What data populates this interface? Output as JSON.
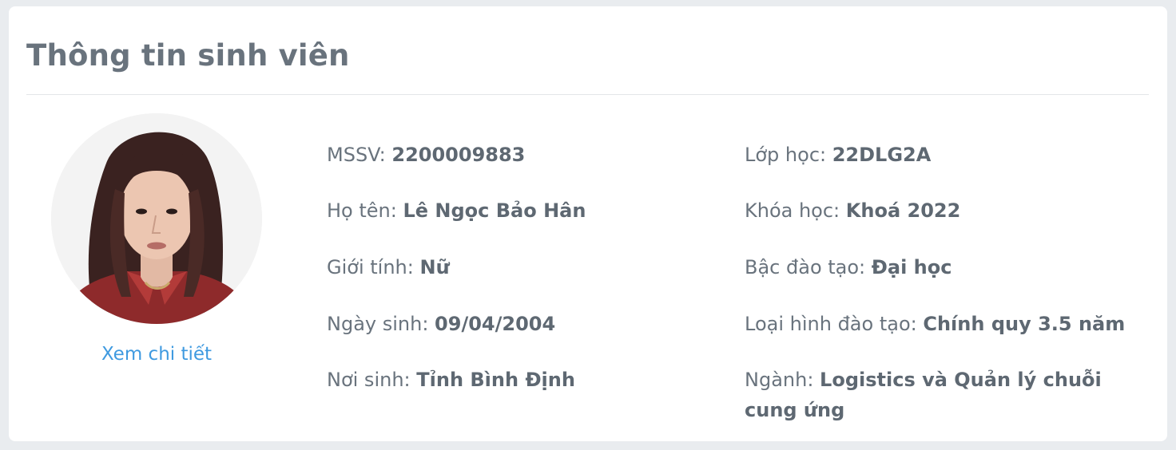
{
  "card": {
    "title": "Thông tin sinh viên",
    "detail_link": "Xem chi tiết"
  },
  "left_fields": [
    {
      "label": "MSSV:",
      "value": "2200009883"
    },
    {
      "label": "Họ tên:",
      "value": "Lê Ngọc Bảo Hân"
    },
    {
      "label": "Giới tính:",
      "value": "Nữ"
    },
    {
      "label": "Ngày sinh:",
      "value": "09/04/2004"
    },
    {
      "label": "Nơi sinh:",
      "value": "Tỉnh Bình Định"
    }
  ],
  "right_fields": [
    {
      "label": "Lớp học:",
      "value": "22DLG2A"
    },
    {
      "label": "Khóa học:",
      "value": "Khoá 2022"
    },
    {
      "label": "Bậc đào tạo:",
      "value": "Đại học"
    },
    {
      "label": "Loại hình đào tạo:",
      "value": "Chính quy 3.5 năm"
    },
    {
      "label": "Ngành:",
      "value": "Logistics và Quản lý chuỗi cung ứng"
    }
  ],
  "colors": {
    "page_bg": "#e9ecef",
    "card_bg": "#ffffff",
    "title": "#69737d",
    "link": "#3f9ae0"
  }
}
